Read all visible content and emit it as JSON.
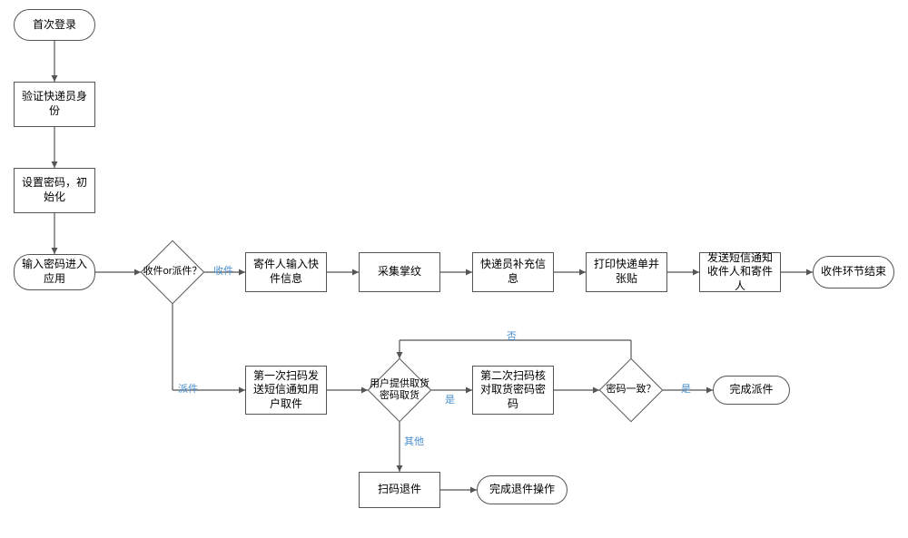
{
  "chart_data": {
    "type": "flowchart",
    "title": "",
    "nodes": [
      {
        "id": "n1",
        "shape": "rounded",
        "text": "首次登录"
      },
      {
        "id": "n2",
        "shape": "rect",
        "text": "验证快递员身份"
      },
      {
        "id": "n3",
        "shape": "rect",
        "text": "设置密码，初始化"
      },
      {
        "id": "n4",
        "shape": "rounded",
        "text": "输入密码进入应用"
      },
      {
        "id": "d1",
        "shape": "diamond",
        "text": "收件or派件？"
      },
      {
        "id": "n5",
        "shape": "rect",
        "text": "寄件人输入快件信息"
      },
      {
        "id": "n6",
        "shape": "rect",
        "text": "采集掌纹"
      },
      {
        "id": "n7",
        "shape": "rect",
        "text": "快递员补充信息"
      },
      {
        "id": "n8",
        "shape": "rect",
        "text": "打印快递单并张贴"
      },
      {
        "id": "n9",
        "shape": "rect",
        "text": "发送短信通知收件人和寄件人"
      },
      {
        "id": "n10",
        "shape": "rounded",
        "text": "收件环节结束"
      },
      {
        "id": "n11",
        "shape": "rect",
        "text": "第一次扫码发送短信通知用户取件"
      },
      {
        "id": "d2",
        "shape": "diamond",
        "text": "用户提供取货密码取货"
      },
      {
        "id": "n12",
        "shape": "rect",
        "text": "第二次扫码核对取货密码密码"
      },
      {
        "id": "d3",
        "shape": "diamond",
        "text": "密码一致？"
      },
      {
        "id": "n13",
        "shape": "rounded",
        "text": "完成派件"
      },
      {
        "id": "n14",
        "shape": "rect",
        "text": "扫码退件"
      },
      {
        "id": "n15",
        "shape": "rounded",
        "text": "完成退件操作"
      }
    ],
    "edges": [
      {
        "from": "n1",
        "to": "n2"
      },
      {
        "from": "n2",
        "to": "n3"
      },
      {
        "from": "n3",
        "to": "n4"
      },
      {
        "from": "n4",
        "to": "d1"
      },
      {
        "from": "d1",
        "to": "n5",
        "label": "收件"
      },
      {
        "from": "n5",
        "to": "n6"
      },
      {
        "from": "n6",
        "to": "n7"
      },
      {
        "from": "n7",
        "to": "n8"
      },
      {
        "from": "n8",
        "to": "n9"
      },
      {
        "from": "n9",
        "to": "n10"
      },
      {
        "from": "d1",
        "to": "n11",
        "label": "派件"
      },
      {
        "from": "n11",
        "to": "d2"
      },
      {
        "from": "d2",
        "to": "n12",
        "label": "是"
      },
      {
        "from": "n12",
        "to": "d3"
      },
      {
        "from": "d3",
        "to": "n13",
        "label": "是"
      },
      {
        "from": "d3",
        "to": "d2",
        "label": "否"
      },
      {
        "from": "d2",
        "to": "n14",
        "label": "其他"
      },
      {
        "from": "n14",
        "to": "n15"
      }
    ]
  },
  "labels": {
    "shoujian": "收件",
    "paijian": "派件",
    "shi1": "是",
    "shi2": "是",
    "fou": "否",
    "qita": "其他"
  }
}
